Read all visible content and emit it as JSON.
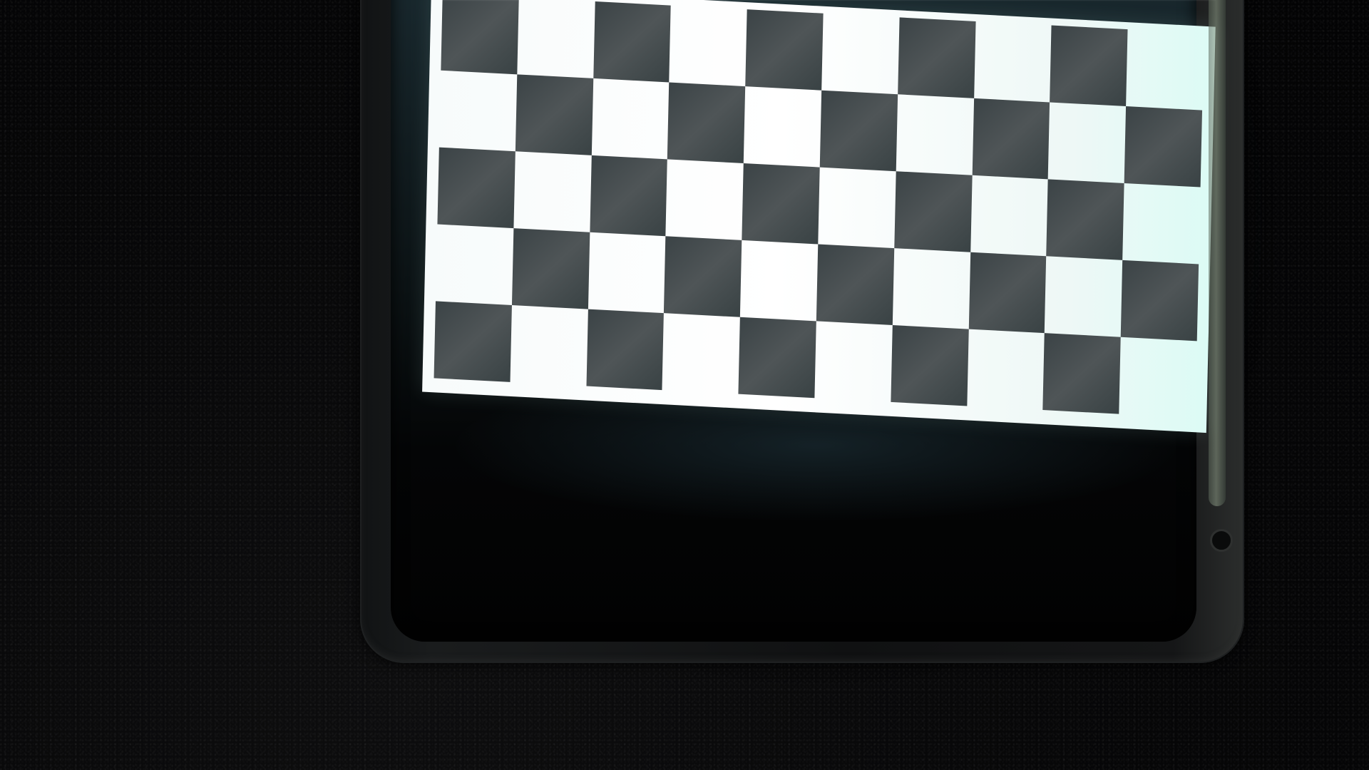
{
  "scene": {
    "subject": "photo",
    "colors": {
      "background": "#050506",
      "frame": "#111314",
      "board_light": "#ffffff",
      "board_dark": "#3f4749",
      "screen_glow": "#1e3238"
    },
    "checkerboard": {
      "rows": 5,
      "columns": 10
    }
  }
}
